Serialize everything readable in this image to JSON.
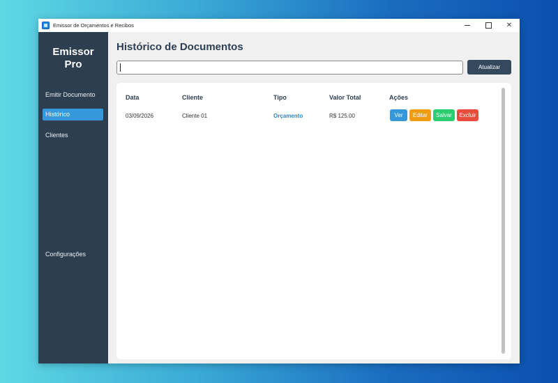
{
  "window": {
    "title": "Emissor de Orçamentos e Recibos",
    "controls": {
      "close": "✕"
    }
  },
  "sidebar": {
    "brand_line1": "Emissor",
    "brand_line2": "Pro",
    "items": [
      {
        "label": "Emitir Documento"
      },
      {
        "label": "Histórico",
        "active": true
      },
      {
        "label": "Clientes"
      },
      {
        "label": "Configurações"
      }
    ]
  },
  "main": {
    "title": "Histórico de Documentos",
    "search": {
      "value": "",
      "placeholder": ""
    },
    "refresh_label": "Atualizar",
    "table": {
      "headers": [
        "Data",
        "Cliente",
        "Tipo",
        "Valor Total",
        "Ações"
      ],
      "rows": [
        {
          "data": "03/09/2026",
          "cliente": "Cliente 01",
          "tipo": "Orçamento",
          "valor": "R$ 125.00",
          "actions": [
            "Ver",
            "Editar",
            "Salvar",
            "Excluir"
          ]
        }
      ]
    }
  },
  "colors": {
    "sidebar_bg": "#2c3e50",
    "active_nav": "#3498db",
    "ver": "#3498db",
    "editar": "#f39c12",
    "salvar": "#2ecc71",
    "excluir": "#e74c3c",
    "refresh": "#34495e"
  }
}
